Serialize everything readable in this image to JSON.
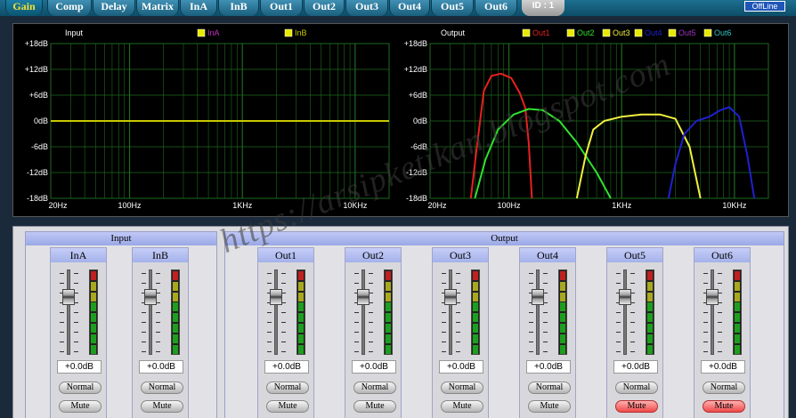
{
  "tabs": [
    {
      "label": "Gain",
      "active": true
    },
    {
      "label": "Comp",
      "active": false
    },
    {
      "label": "Delay",
      "active": false
    },
    {
      "label": "Matrix",
      "active": false
    },
    {
      "label": "InA",
      "active": false
    },
    {
      "label": "InB",
      "active": false
    },
    {
      "label": "Out1",
      "active": false
    },
    {
      "label": "Out2",
      "active": false
    },
    {
      "label": "Out3",
      "active": false
    },
    {
      "label": "Out4",
      "active": false
    },
    {
      "label": "Out5",
      "active": false
    },
    {
      "label": "Out6",
      "active": false
    }
  ],
  "device_id": "ID : 1",
  "status": "OffLine",
  "colors": {
    "inA": "#c030c0",
    "inB": "#c8c800",
    "out1": "#e82020",
    "out2": "#30e030",
    "out3": "#f0f040",
    "out4": "#2020d0",
    "out5": "#a030c0",
    "out6": "#30c0c0",
    "grid": "#1e6a1e",
    "checkbox": "#e8e800"
  },
  "chart_data": [
    {
      "type": "line",
      "title": "Input",
      "y_ticks": [
        "+18dB",
        "+12dB",
        "+6dB",
        "0dB",
        "-6dB",
        "-12dB",
        "-18dB"
      ],
      "x_ticks": [
        "20Hz",
        "100Hz",
        "1KHz",
        "10KHz"
      ],
      "ylim": [
        -18,
        18
      ],
      "xlim": [
        20,
        20000
      ],
      "xscale": "log",
      "series": [
        {
          "name": "InA",
          "x": [
            20,
            20000
          ],
          "y": [
            0,
            0
          ]
        },
        {
          "name": "InB",
          "x": [
            20,
            20000
          ],
          "y": [
            0,
            0
          ]
        }
      ]
    },
    {
      "type": "line",
      "title": "Output",
      "y_ticks": [
        "+18dB",
        "+12dB",
        "+6dB",
        "0dB",
        "-6dB",
        "-12dB",
        "-18dB"
      ],
      "x_ticks": [
        "20Hz",
        "100Hz",
        "1KHz",
        "10KHz"
      ],
      "ylim": [
        -18,
        18
      ],
      "xlim": [
        20,
        20000
      ],
      "xscale": "log",
      "series": [
        {
          "name": "Out1",
          "x": [
            46,
            52,
            60,
            70,
            85,
            105,
            125,
            140,
            150,
            160
          ],
          "y": [
            -18,
            -6,
            7,
            10.5,
            11,
            10,
            6.5,
            3,
            -5,
            -18
          ]
        },
        {
          "name": "Out2",
          "x": [
            50,
            62,
            80,
            110,
            150,
            200,
            280,
            400,
            600,
            800
          ],
          "y": [
            -18,
            -9,
            -2,
            1.5,
            2.8,
            2.5,
            0,
            -5,
            -12,
            -18
          ]
        },
        {
          "name": "Out3",
          "x": [
            400,
            480,
            560,
            700,
            1000,
            1500,
            2200,
            3000,
            4000,
            5000
          ],
          "y": [
            -18,
            -8,
            -2,
            0,
            1,
            1.5,
            1.5,
            0.5,
            -6,
            -18
          ]
        },
        {
          "name": "Out4",
          "x": [
            2600,
            3000,
            3600,
            4600,
            6000,
            7500,
            9000,
            11000,
            13000,
            15000
          ],
          "y": [
            -18,
            -10,
            -3,
            0,
            1,
            2.5,
            3.2,
            1,
            -8,
            -18
          ]
        },
        {
          "name": "Out5",
          "x": [],
          "y": []
        },
        {
          "name": "Out6",
          "x": [],
          "y": []
        }
      ]
    }
  ],
  "input_group_title": "Input",
  "output_group_title": "Output",
  "channels": [
    {
      "name": "InA",
      "gain": "+0.0dB",
      "mode": "Normal",
      "mute": "Mute",
      "muted": false
    },
    {
      "name": "InB",
      "gain": "+0.0dB",
      "mode": "Normal",
      "mute": "Mute",
      "muted": false
    },
    {
      "name": "Out1",
      "gain": "+0.0dB",
      "mode": "Normal",
      "mute": "Mute",
      "muted": false
    },
    {
      "name": "Out2",
      "gain": "+0.0dB",
      "mode": "Normal",
      "mute": "Mute",
      "muted": false
    },
    {
      "name": "Out3",
      "gain": "+0.0dB",
      "mode": "Normal",
      "mute": "Mute",
      "muted": false
    },
    {
      "name": "Out4",
      "gain": "+0.0dB",
      "mode": "Normal",
      "mute": "Mute",
      "muted": false
    },
    {
      "name": "Out5",
      "gain": "+0.0dB",
      "mode": "Normal",
      "mute": "Mute",
      "muted": true
    },
    {
      "name": "Out6",
      "gain": "+0.0dB",
      "mode": "Normal",
      "mute": "Mute",
      "muted": true
    }
  ],
  "watermark": "https://arsipketikan.blogspot.com"
}
